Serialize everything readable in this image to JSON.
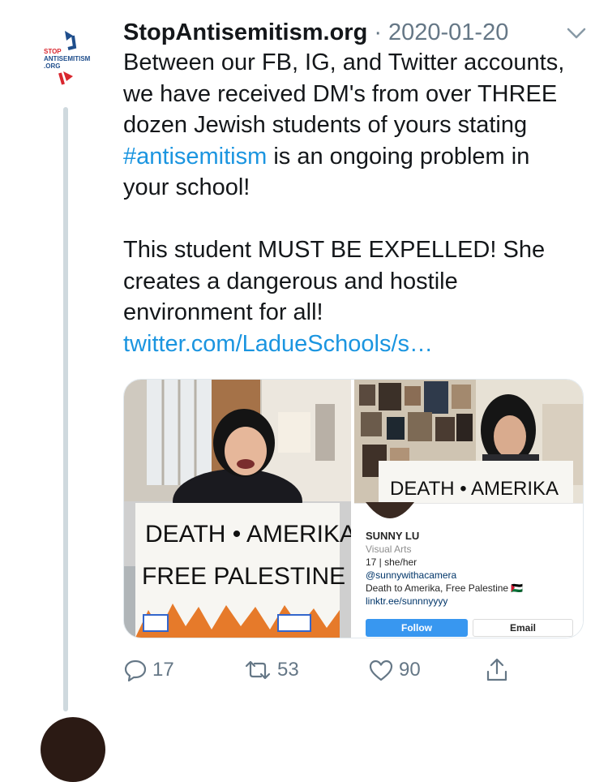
{
  "tweet": {
    "author_name": "StopAntisemitism.org",
    "separator": "·",
    "date": "2020-01-20",
    "logo_text": {
      "line1": "STOP",
      "line2": "ANTISEMITISM",
      "line3": ".ORG"
    },
    "text_part1": "Between our FB, IG, and Twitter accounts, we have received DM's from over THREE dozen Jewish students of yours stating ",
    "hashtag": "#antisemitism",
    "text_part2": " is an ongoing problem in your school!",
    "text_para2": "This student MUST BE EXPELLED! She creates a dangerous and hostile environment for all! ",
    "link": "twitter.com/LadueSchools/s…"
  },
  "media": {
    "left_sign": {
      "line1": "DEATH • AMERIKA",
      "line2": "FREE PALESTINE"
    },
    "right_sign": "DEATH • AMERIKA",
    "instagram": {
      "name": "SUNNY LU",
      "category": "Visual Arts",
      "bio_line1": "17 | she/her",
      "bio_line2": "@sunnywithacamera",
      "bio_line3": "Death to Amerika, Free Palestine 🇵🇸",
      "bio_link": "linktr.ee/sunnnyyyy",
      "follow_label": "Follow",
      "email_label": "Email"
    }
  },
  "actions": {
    "reply_count": "17",
    "retweet_count": "53",
    "like_count": "90"
  },
  "colors": {
    "link": "#1b95e0",
    "secondary_text": "#657786",
    "thread_line": "#cfd9de",
    "logo_blue": "#1f4e8c",
    "logo_red": "#d9262e"
  }
}
